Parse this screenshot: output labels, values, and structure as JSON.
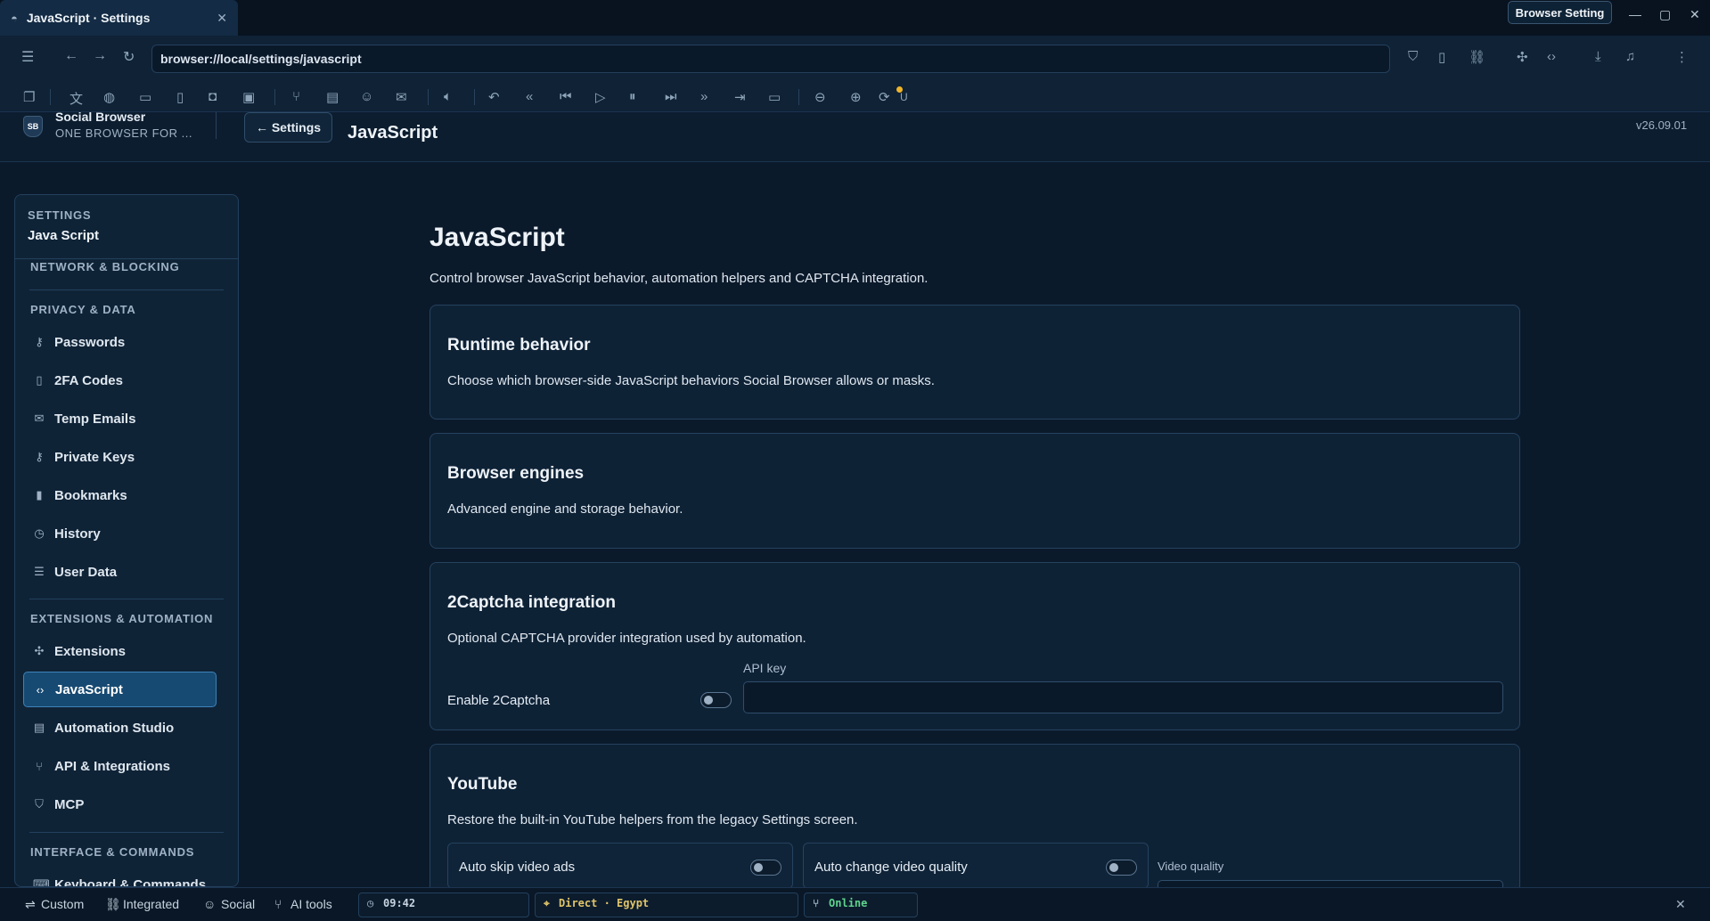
{
  "window": {
    "tab_title": "JavaScript · Settings",
    "browser_setting_label": "Browser Setting"
  },
  "nav": {
    "url": "browser://local/settings/javascript"
  },
  "toolbar": {
    "badge_letter": "U",
    "badge_color": "#f0b429"
  },
  "header": {
    "logo_text": "SB",
    "brand_name": "Social Browser",
    "brand_tagline": "ONE BROWSER FOR ...",
    "back_label": "← Settings",
    "title": "JavaScript",
    "version": "v26.09.01"
  },
  "sidebar": {
    "head_small": "SETTINGS",
    "head_big": "Java Script",
    "sections": [
      {
        "label": "NETWORK & BLOCKING"
      },
      {
        "label": "PRIVACY & DATA"
      },
      {
        "label": "EXTENSIONS & AUTOMATION"
      },
      {
        "label": "INTERFACE & COMMANDS"
      }
    ],
    "items": [
      {
        "label": "Passwords",
        "icon": "key-icon"
      },
      {
        "label": "2FA Codes",
        "icon": "phone-icon"
      },
      {
        "label": "Temp Emails",
        "icon": "mail-icon"
      },
      {
        "label": "Private Keys",
        "icon": "key-icon"
      },
      {
        "label": "Bookmarks",
        "icon": "bookmark-icon"
      },
      {
        "label": "History",
        "icon": "clock-icon"
      },
      {
        "label": "User Data",
        "icon": "database-icon"
      },
      {
        "label": "Extensions",
        "icon": "puzzle-icon"
      },
      {
        "label": "JavaScript",
        "icon": "code-icon",
        "active": true
      },
      {
        "label": "Automation Studio",
        "icon": "terminal-icon"
      },
      {
        "label": "API & Integrations",
        "icon": "network-icon"
      },
      {
        "label": "MCP",
        "icon": "shield-icon"
      },
      {
        "label": "Keyboard & Commands",
        "icon": "keyboard-icon"
      }
    ]
  },
  "main": {
    "title": "JavaScript",
    "description": "Control browser JavaScript behavior, automation helpers and CAPTCHA integration.",
    "cards": {
      "runtime": {
        "title": "Runtime behavior",
        "description": "Choose which browser-side JavaScript behaviors Social Browser allows or masks."
      },
      "engines": {
        "title": "Browser engines",
        "description": "Advanced engine and storage behavior."
      },
      "captcha": {
        "title": "2Captcha integration",
        "description": "Optional CAPTCHA provider integration used by automation.",
        "api_key_label": "API key",
        "api_key_value": "",
        "enable_label": "Enable 2Captcha",
        "enabled": false
      },
      "youtube": {
        "title": "YouTube",
        "description": "Restore the built-in YouTube helpers from the legacy Settings screen.",
        "auto_skip_label": "Auto skip video ads",
        "auto_skip": false,
        "auto_quality_label": "Auto change video quality",
        "auto_quality": false,
        "video_quality_label": "Video quality"
      }
    }
  },
  "status": {
    "custom_label": "Custom",
    "integrated_label": "Integrated",
    "social_label": "Social",
    "ai_tools_label": "AI tools",
    "time": "09:42",
    "route": "Direct · Egypt",
    "online": "Online",
    "route_color": "#e0c46a",
    "online_color": "#5fd38d"
  }
}
